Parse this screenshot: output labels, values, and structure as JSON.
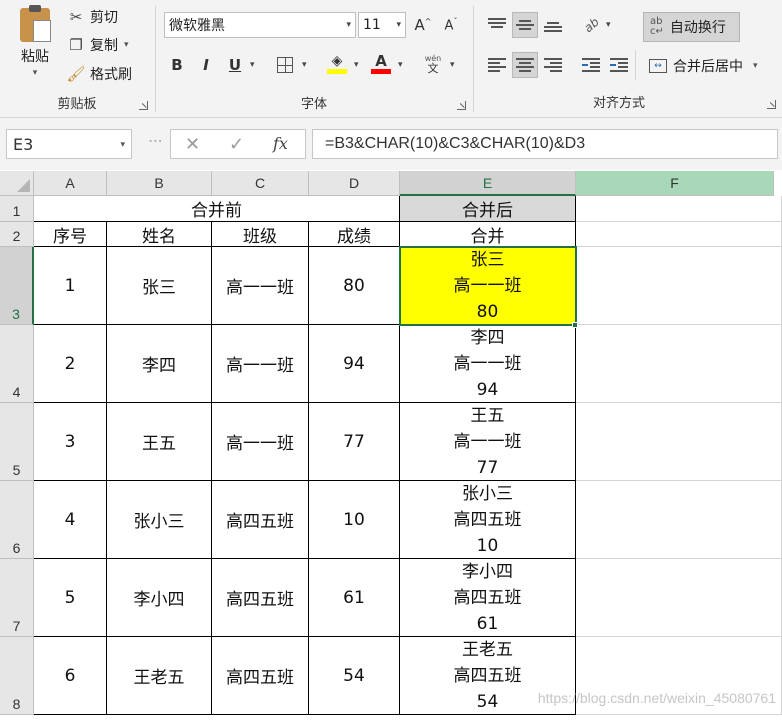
{
  "ribbon": {
    "clipboard": {
      "paste_label": "粘贴",
      "cut_label": "剪切",
      "copy_label": "复制",
      "format_painter_label": "格式刷",
      "group_label": "剪贴板"
    },
    "font": {
      "font_name": "微软雅黑",
      "font_size": "11",
      "group_label": "字体",
      "bold": "B",
      "italic": "I",
      "underline": "U",
      "font_color_glyph": "A",
      "font_color": "#ff0000",
      "fill_color": "#ffff00",
      "phonetic_label": "wén"
    },
    "alignment": {
      "wrap_text_label": "自动换行",
      "merge_center_label": "合并后居中",
      "group_label": "对齐方式",
      "orientation_glyph": "ab"
    }
  },
  "formula_bar": {
    "name_box": "E3",
    "cancel_glyph": "✕",
    "enter_glyph": "✓",
    "fx_label": "fx",
    "formula": "=B3&CHAR(10)&C3&CHAR(10)&D3"
  },
  "sheet": {
    "columns": [
      "A",
      "B",
      "C",
      "D",
      "E",
      "F"
    ],
    "rows": [
      "1",
      "2",
      "3",
      "4",
      "5",
      "6",
      "7",
      "8"
    ],
    "active_cell": "E3",
    "accent_color": "#217346",
    "header_merged_before": "合并前",
    "header_merged_after": "合并后",
    "col_headers": [
      "序号",
      "姓名",
      "班级",
      "成绩",
      "合并"
    ],
    "data": [
      {
        "no": "1",
        "name": "张三",
        "class": "高一一班",
        "score": "80",
        "merged": [
          "张三",
          "高一一班",
          "80"
        ]
      },
      {
        "no": "2",
        "name": "李四",
        "class": "高一一班",
        "score": "94",
        "merged": [
          "李四",
          "高一一班",
          "94"
        ]
      },
      {
        "no": "3",
        "name": "王五",
        "class": "高一一班",
        "score": "77",
        "merged": [
          "王五",
          "高一一班",
          "77"
        ]
      },
      {
        "no": "4",
        "name": "张小三",
        "class": "高四五班",
        "score": "10",
        "merged": [
          "张小三",
          "高四五班",
          "10"
        ]
      },
      {
        "no": "5",
        "name": "李小四",
        "class": "高四五班",
        "score": "61",
        "merged": [
          "李小四",
          "高四五班",
          "61"
        ]
      },
      {
        "no": "6",
        "name": "王老五",
        "class": "高四五班",
        "score": "54",
        "merged": [
          "王老五",
          "高四五班",
          "54"
        ]
      }
    ]
  },
  "watermark": "https://blog.csdn.net/weixin_45080761"
}
